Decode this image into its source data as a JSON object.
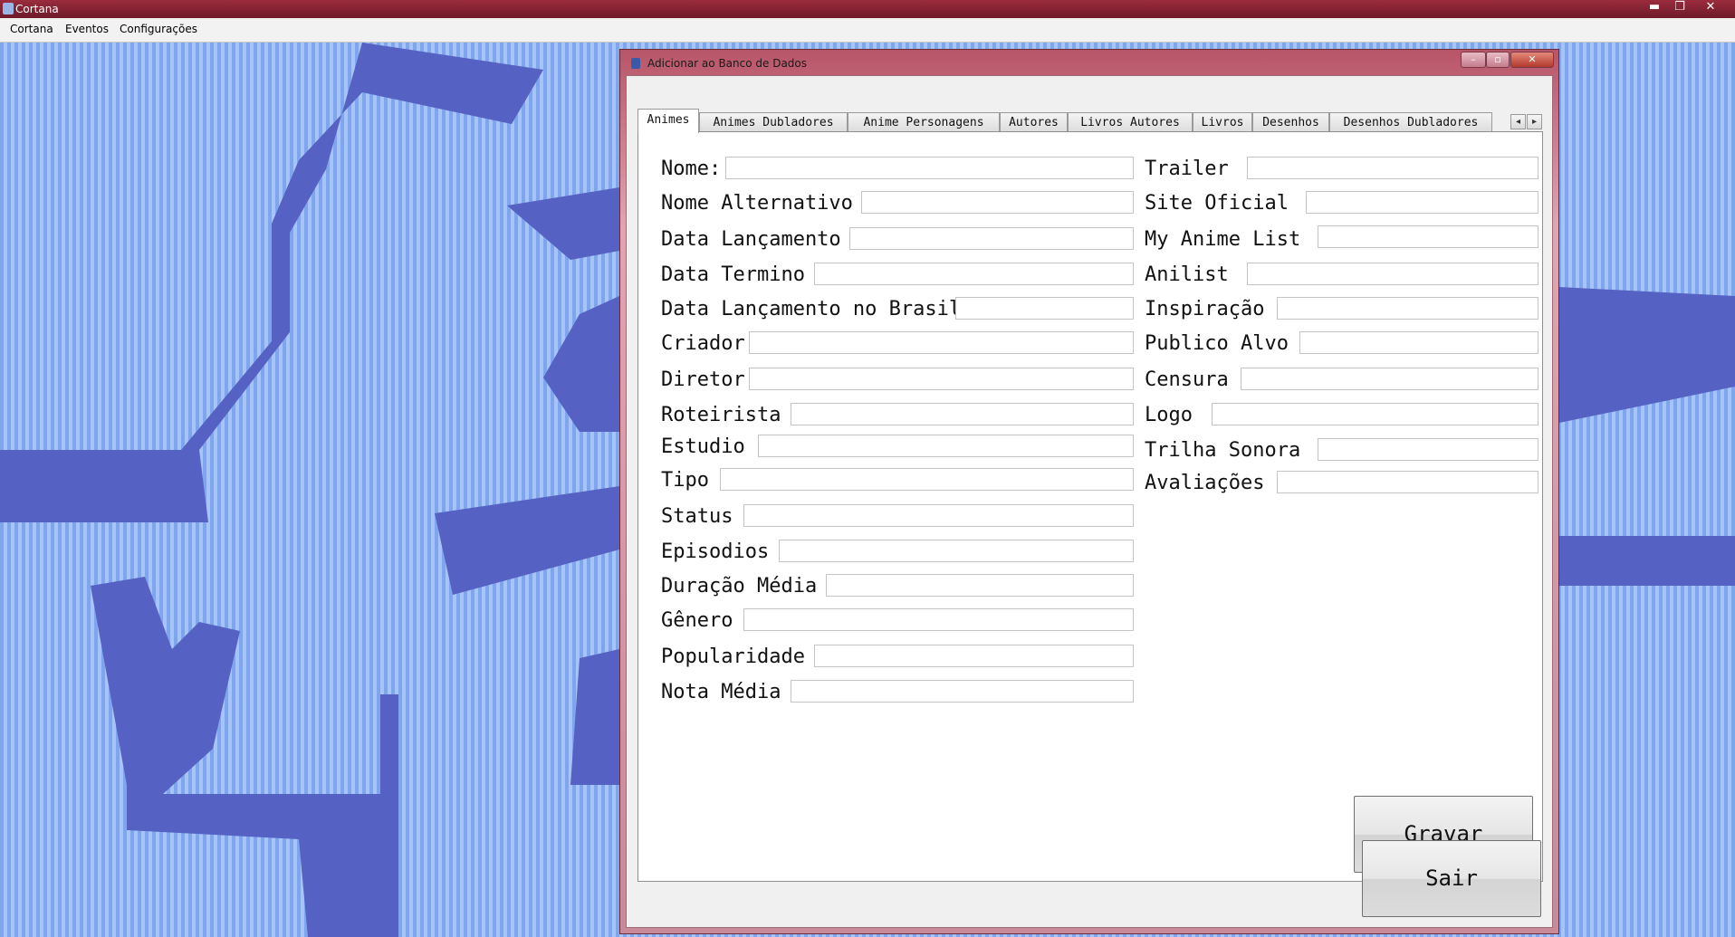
{
  "app": {
    "title": "Cortana",
    "controls": {
      "minimize": "▬",
      "restore": "❐",
      "close": "✕"
    }
  },
  "menu": [
    "Cortana",
    "Eventos",
    "Configurações"
  ],
  "dialog": {
    "title": "Adicionar ao Banco de Dados",
    "controls": {
      "minimize": "–",
      "restore": "▫",
      "close": "✕"
    },
    "tabs": [
      "Animes",
      "Animes Dubladores",
      "Anime Personagens",
      "Autores",
      "Livros Autores",
      "Livros",
      "Desenhos",
      "Desenhos Dubladores"
    ],
    "tab_scroll": {
      "left": "◂",
      "right": "▸"
    },
    "left_fields": [
      {
        "label": "Nome:",
        "value": ""
      },
      {
        "label": "Nome Alternativo",
        "value": ""
      },
      {
        "label": "Data Lançamento",
        "value": ""
      },
      {
        "label": "Data Termino",
        "value": ""
      },
      {
        "label": "Data Lançamento no Brasil",
        "value": ""
      },
      {
        "label": "Criador",
        "value": ""
      },
      {
        "label": "Diretor",
        "value": ""
      },
      {
        "label": "Roteirista",
        "value": ""
      },
      {
        "label": "Estudio",
        "value": ""
      },
      {
        "label": "Tipo",
        "value": ""
      },
      {
        "label": "Status",
        "value": ""
      },
      {
        "label": "Episodios",
        "value": ""
      },
      {
        "label": "Duração Média",
        "value": ""
      },
      {
        "label": "Gênero",
        "value": ""
      },
      {
        "label": "Popularidade",
        "value": ""
      },
      {
        "label": "Nota Média",
        "value": ""
      }
    ],
    "right_fields": [
      {
        "label": "Trailer",
        "value": ""
      },
      {
        "label": "Site Oficial",
        "value": ""
      },
      {
        "label": "My Anime List",
        "value": ""
      },
      {
        "label": "Anilist",
        "value": ""
      },
      {
        "label": "Inspiração",
        "value": ""
      },
      {
        "label": "Publico Alvo",
        "value": ""
      },
      {
        "label": "Censura",
        "value": ""
      },
      {
        "label": "Logo",
        "value": ""
      },
      {
        "label": "Trilha Sonora",
        "value": ""
      },
      {
        "label": "Avaliações",
        "value": ""
      }
    ],
    "save_button": "Gravar",
    "exit_button": "Sair"
  },
  "colors": {
    "desktop_stripe_a": "#7fa6ec",
    "desktop_stripe_b": "#a7c4f8",
    "desktop_shapes": "#5661c4",
    "window_frame": "#c98a98"
  }
}
